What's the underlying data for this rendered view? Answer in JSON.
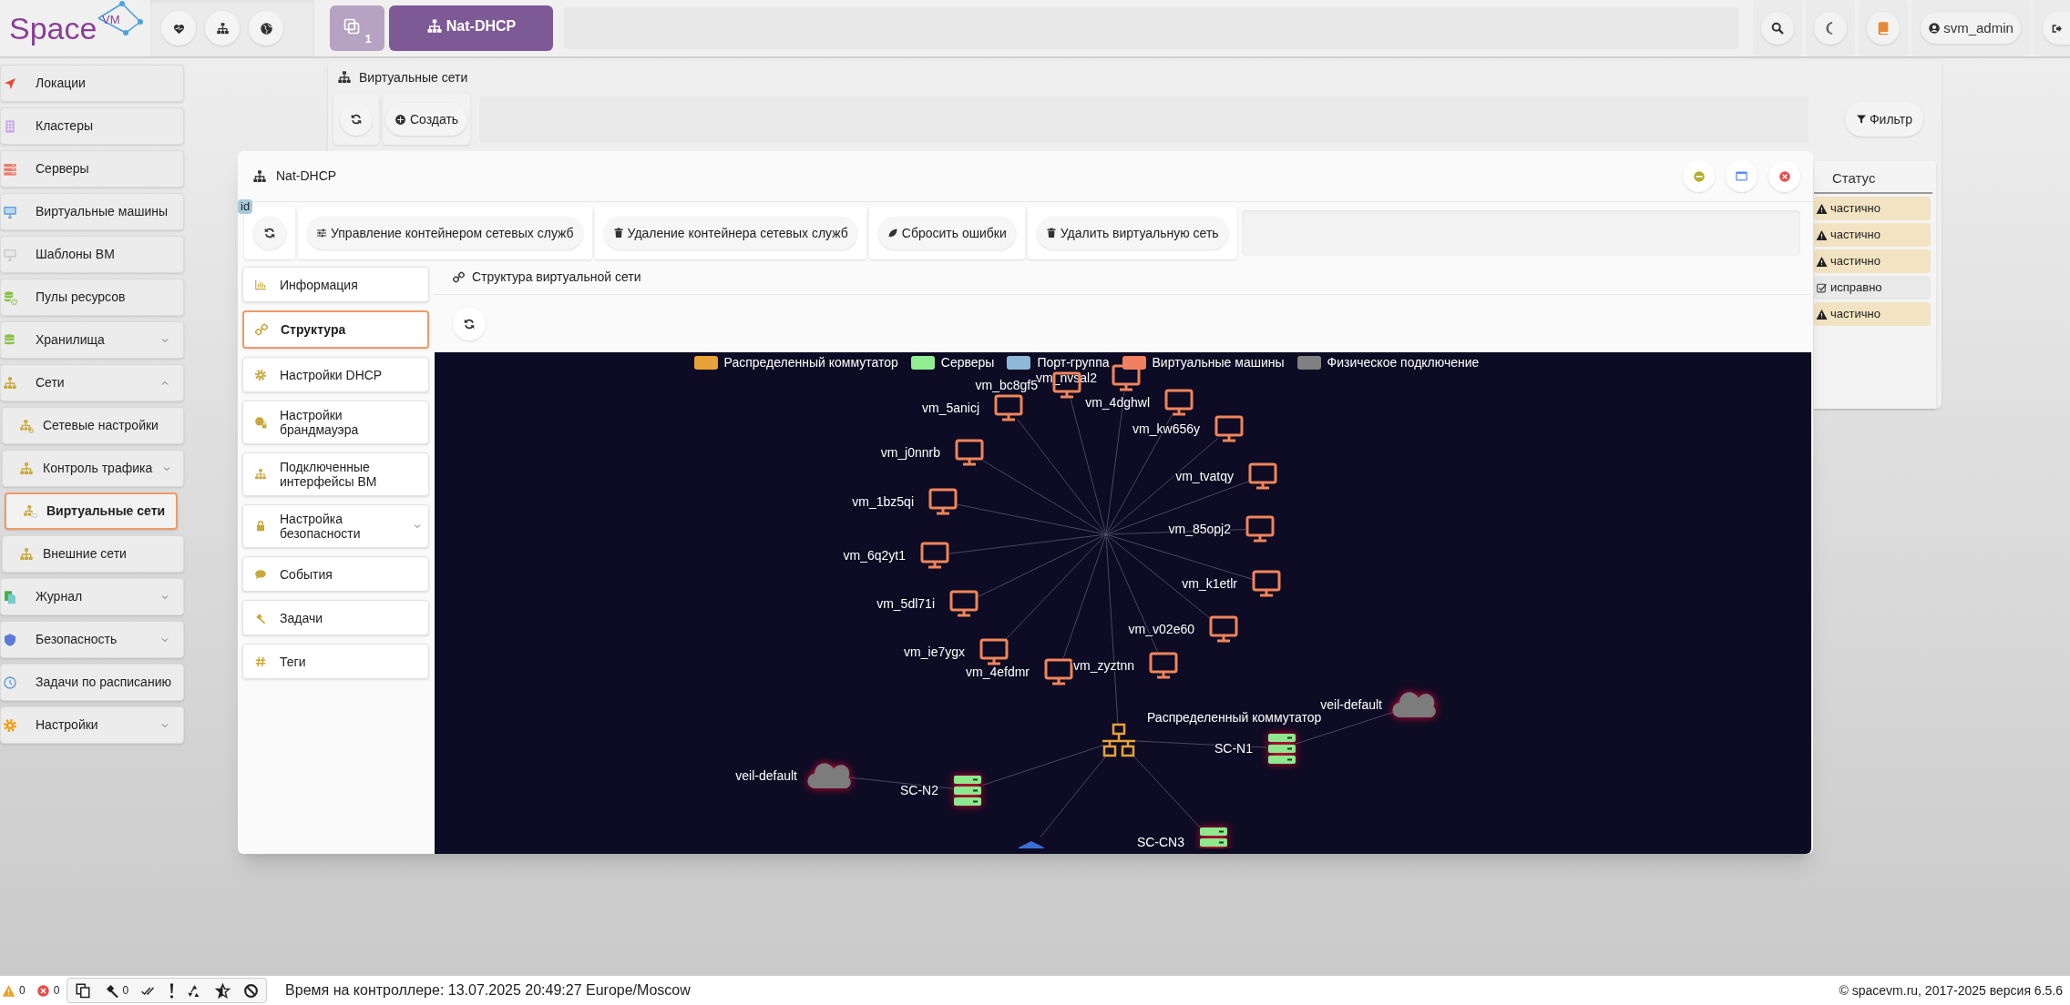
{
  "header": {
    "logo": "Space",
    "logo_badge": "VM",
    "tabs": [
      {
        "label": "1",
        "kind": "windows",
        "selected": false
      },
      {
        "label": "Nat-DHCP",
        "kind": "network",
        "selected": true
      }
    ],
    "user": "svm_admin"
  },
  "sidebar": {
    "items": [
      {
        "label": "Локации",
        "selected": false
      },
      {
        "label": "Кластеры",
        "selected": false
      },
      {
        "label": "Серверы",
        "selected": false
      },
      {
        "label": "Виртуальные машины",
        "selected": false
      },
      {
        "label": "Шаблоны ВМ",
        "selected": false
      },
      {
        "label": "Пулы ресурсов",
        "selected": false
      },
      {
        "label": "Хранилища",
        "selected": false,
        "expanded": false
      },
      {
        "label": "Сети",
        "selected": false,
        "expanded": true,
        "children": [
          {
            "label": "Сетевые настройки",
            "selected": false
          },
          {
            "label": "Контроль трафика",
            "selected": false,
            "expanded": false
          },
          {
            "label": "Виртуальные сети",
            "selected": true
          },
          {
            "label": "Внешние сети",
            "selected": false
          }
        ]
      },
      {
        "label": "Журнал",
        "selected": false,
        "expanded": false
      },
      {
        "label": "Безопасность",
        "selected": false,
        "expanded": false
      },
      {
        "label": "Задачи по расписанию",
        "selected": false
      },
      {
        "label": "Настройки",
        "selected": false,
        "expanded": false
      }
    ]
  },
  "list_window": {
    "title": "Виртуальные сети",
    "create_button": "Создать",
    "filter_button": "Фильтр",
    "status_column": "Статус",
    "statuses": [
      {
        "label": "частично",
        "kind": "warning"
      },
      {
        "label": "частично",
        "kind": "warning"
      },
      {
        "label": "частично",
        "kind": "warning"
      },
      {
        "label": "исправно",
        "kind": "ok"
      },
      {
        "label": "частично",
        "kind": "warning"
      }
    ]
  },
  "modal": {
    "title": "Nat-DHCP",
    "id_badge": "id",
    "actions": [
      "Управление контейнером сетевых служб",
      "Удаление контейнера сетевых служб",
      "Сбросить ошибки",
      "Удалить виртуальную сеть"
    ],
    "menu": [
      {
        "label": "Информация",
        "selected": false
      },
      {
        "label": "Структура",
        "selected": true
      },
      {
        "label": "Настройки DHCP",
        "selected": false
      },
      {
        "label": "Настройки брандмауэра",
        "selected": false
      },
      {
        "label": "Подключенные интерфейсы ВМ",
        "selected": false
      },
      {
        "label": "Настройка безопасности",
        "selected": false,
        "expanded": false
      },
      {
        "label": "События",
        "selected": false
      },
      {
        "label": "Задачи",
        "selected": false
      },
      {
        "label": "Теги",
        "selected": false
      }
    ],
    "section_title": "Структура виртуальной сети",
    "graph": {
      "legend": [
        {
          "label": "Распределенный коммутатор",
          "color": "#e8a23a"
        },
        {
          "label": "Серверы",
          "color": "#90ee90"
        },
        {
          "label": "Порт-группа",
          "color": "#8fb8d8"
        },
        {
          "label": "Виртуальные машины",
          "color": "#f08060"
        },
        {
          "label": "Физическое подключение",
          "color": "#808080"
        }
      ],
      "nodes": [
        {
          "kind": "hub",
          "alert": false
        },
        {
          "kind": "vm",
          "label": "vm_nvsal2",
          "alert": false
        },
        {
          "kind": "vm",
          "label": "vm_bc8gf5",
          "alert": false
        },
        {
          "kind": "vm",
          "label": "vm_5anicj",
          "alert": false
        },
        {
          "kind": "vm",
          "label": "vm_4dghwl",
          "alert": false
        },
        {
          "kind": "vm",
          "label": "vm_kw656y",
          "alert": false
        },
        {
          "kind": "vm",
          "label": "vm_j0nnrb",
          "alert": false
        },
        {
          "kind": "vm",
          "label": "vm_tvatqy",
          "alert": false
        },
        {
          "kind": "vm",
          "label": "vm_1bz5qi",
          "alert": false
        },
        {
          "kind": "vm",
          "label": "vm_85opj2",
          "alert": false
        },
        {
          "kind": "vm",
          "label": "vm_6q2yt1",
          "alert": false
        },
        {
          "kind": "vm",
          "label": "vm_k1etlr",
          "alert": false
        },
        {
          "kind": "vm",
          "label": "vm_5dl71i",
          "alert": false
        },
        {
          "kind": "vm",
          "label": "vm_v02e60",
          "alert": false
        },
        {
          "kind": "vm",
          "label": "vm_ie7ygx",
          "alert": false
        },
        {
          "kind": "vm",
          "label": "vm_4efdmr",
          "alert": false
        },
        {
          "kind": "vm",
          "label": "vm_zyztnn",
          "alert": false
        },
        {
          "kind": "switch",
          "label": "Распределенный коммутатор",
          "alert": false
        },
        {
          "kind": "server",
          "label": "SC-N1",
          "alert": true
        },
        {
          "kind": "cloud",
          "label": "veil-default",
          "alert": true
        },
        {
          "kind": "server",
          "label": "SC-N2",
          "alert": true
        },
        {
          "kind": "cloud",
          "label": "veil-default",
          "alert": true
        },
        {
          "kind": "server",
          "label": "SC-CN3",
          "alert": true
        },
        {
          "kind": "portgroup",
          "alert": false
        }
      ]
    }
  },
  "status_bar": {
    "warnings": "0",
    "errors": "0",
    "tasks": "0",
    "time": "Время на контроллере: 13.07.2025 20:49:27 Europe/Moscow",
    "copyright": "© spacevm.ru, 2017-2025 версия 6.5.6"
  }
}
